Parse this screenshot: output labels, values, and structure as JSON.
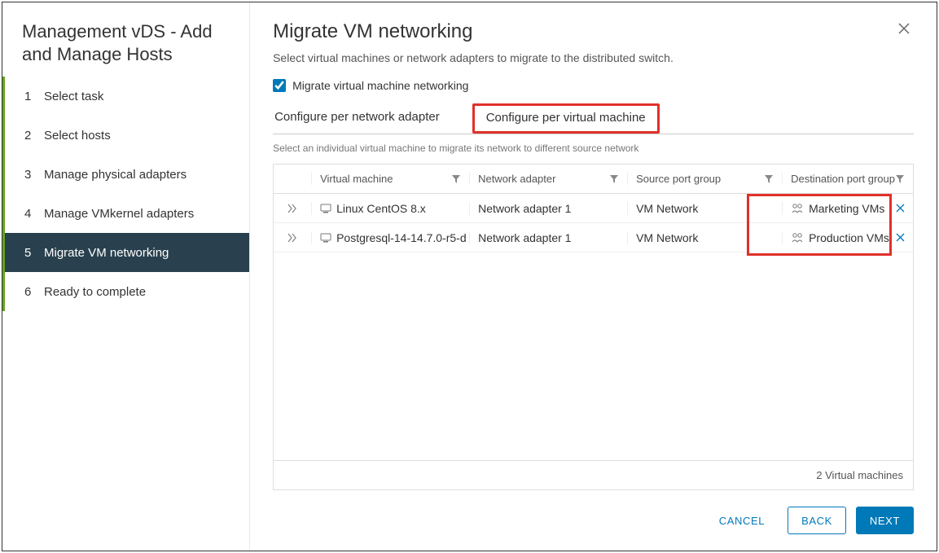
{
  "sidebar": {
    "title": "Management vDS - Add and Manage Hosts",
    "steps": [
      {
        "num": "1",
        "label": "Select task"
      },
      {
        "num": "2",
        "label": "Select hosts"
      },
      {
        "num": "3",
        "label": "Manage physical adapters"
      },
      {
        "num": "4",
        "label": "Manage VMkernel adapters"
      },
      {
        "num": "5",
        "label": "Migrate VM networking"
      },
      {
        "num": "6",
        "label": "Ready to complete"
      }
    ],
    "active_index": 4
  },
  "main": {
    "title": "Migrate VM networking",
    "description": "Select virtual machines or network adapters to migrate to the distributed switch.",
    "checkbox_label": "Migrate virtual machine networking",
    "checkbox_checked": true,
    "tabs": [
      {
        "label": "Configure per network adapter",
        "active": false
      },
      {
        "label": "Configure per virtual machine",
        "active": true
      }
    ],
    "subhint": "Select an individual virtual machine to migrate its network to different source network",
    "columns": {
      "vm": "Virtual machine",
      "na": "Network adapter",
      "src": "Source port group",
      "dst": "Destination port group"
    },
    "rows": [
      {
        "vm": "Linux CentOS 8.x",
        "na": "Network adapter 1",
        "src": "VM Network",
        "dst": "Marketing VMs"
      },
      {
        "vm": "Postgresql-14-14.7.0-r5-d",
        "na": "Network adapter 1",
        "src": "VM Network",
        "dst": "Production VMs"
      }
    ],
    "footer": "2 Virtual machines"
  },
  "actions": {
    "cancel": "CANCEL",
    "back": "BACK",
    "next": "NEXT"
  }
}
